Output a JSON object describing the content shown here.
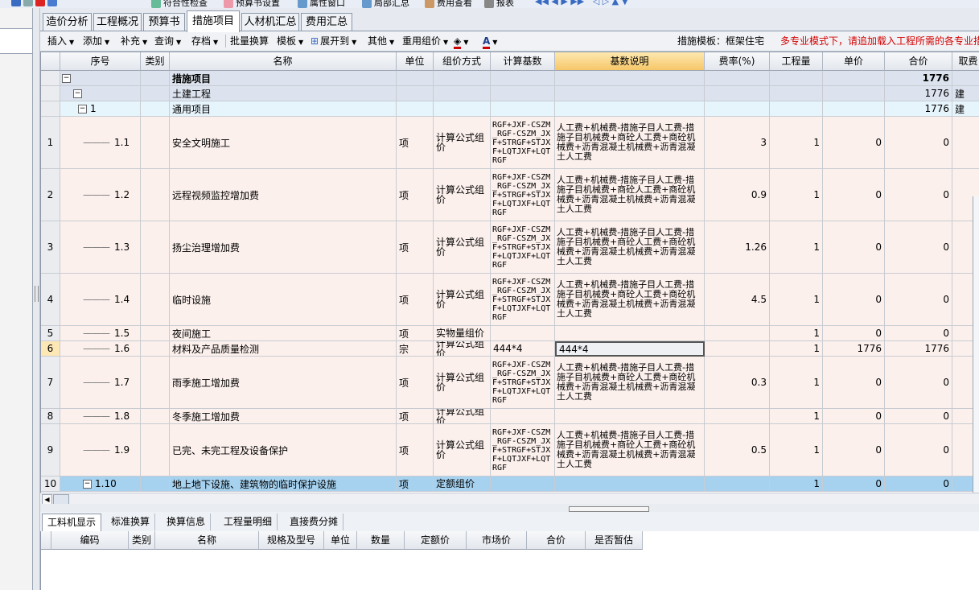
{
  "top_toolbar": {
    "items": [
      "符合性检查",
      "预算书设置",
      "属性窗口",
      "局部汇总",
      "费用查看",
      "报表"
    ]
  },
  "tabs": [
    {
      "label": "造价分析",
      "active": false
    },
    {
      "label": "工程概况",
      "active": false
    },
    {
      "label": "预算书",
      "active": false
    },
    {
      "label": "措施项目",
      "active": true
    },
    {
      "label": "人材机汇总",
      "active": false
    },
    {
      "label": "费用汇总",
      "active": false
    }
  ],
  "toolbar": {
    "insert": "插入",
    "add": "添加",
    "supplement": "补充",
    "query": "查询",
    "archive": "存档",
    "batch_convert": "批量换算",
    "template": "模板",
    "expand_to": "展开到",
    "other": "其他",
    "reuse_group": "重用组价",
    "template_status_label": "措施模板：框架住宅",
    "warning": "多专业模式下，请追加载入工程所需的各专业措施",
    "fill_color": "#cc0000",
    "font_color": "#cc0000"
  },
  "grid": {
    "columns": [
      "序号",
      "类别",
      "名称",
      "单位",
      "组价方式",
      "计算基数",
      "基数说明",
      "费率(%)",
      "工程量",
      "单价",
      "合价",
      "取费"
    ],
    "highlight_column": "基数说明",
    "group_rows": [
      {
        "name": "措施项目",
        "total": "1776",
        "level": 0,
        "bold": true
      },
      {
        "name": "土建工程",
        "total": "1776",
        "level": 1,
        "bold": false,
        "extra": "建"
      },
      {
        "code": "1",
        "name": "通用项目",
        "total": "1776",
        "level": 2,
        "bold": false,
        "extra": "建"
      }
    ],
    "formula": "RGF+JXF-CSZM_RGF-CSZM_JXF+STRGF+STJXF+LQTJXF+LQTRGF",
    "formula_desc": "人工费+机械费-措施子目人工费-措施子目机械费+商砼人工费+商砼机械费+沥青混凝土机械费+沥青混凝土人工费",
    "rows": [
      {
        "no": "1",
        "code": "1.1",
        "name": "安全文明施工",
        "unit": "项",
        "method": "计算公式组价",
        "base": "formula",
        "desc": "formula",
        "rate": "3",
        "qty": "1",
        "price": "0",
        "total": "0"
      },
      {
        "no": "2",
        "code": "1.2",
        "name": "远程视频监控增加费",
        "unit": "项",
        "method": "计算公式组价",
        "base": "formula",
        "desc": "formula",
        "rate": "0.9",
        "qty": "1",
        "price": "0",
        "total": "0"
      },
      {
        "no": "3",
        "code": "1.3",
        "name": "扬尘治理增加费",
        "unit": "项",
        "method": "计算公式组价",
        "base": "formula",
        "desc": "formula",
        "rate": "1.26",
        "qty": "1",
        "price": "0",
        "total": "0"
      },
      {
        "no": "4",
        "code": "1.4",
        "name": "临时设施",
        "unit": "项",
        "method": "计算公式组价",
        "base": "formula",
        "desc": "formula",
        "rate": "4.5",
        "qty": "1",
        "price": "0",
        "total": "0"
      },
      {
        "no": "5",
        "code": "1.5",
        "name": "夜间施工",
        "unit": "项",
        "method": "实物量组价",
        "base": "",
        "desc": "",
        "rate": "",
        "qty": "1",
        "price": "0",
        "total": "0"
      },
      {
        "no": "6",
        "code": "1.6",
        "name": "材料及产品质量检测",
        "unit": "宗",
        "method": "计算公式组价",
        "base": "444*4",
        "desc": "444*4",
        "rate": "",
        "qty": "1",
        "price": "1776",
        "total": "1776",
        "selected": true
      },
      {
        "no": "7",
        "code": "1.7",
        "name": "雨季施工增加费",
        "unit": "项",
        "method": "计算公式组价",
        "base": "formula",
        "desc": "formula",
        "rate": "0.3",
        "qty": "1",
        "price": "0",
        "total": "0"
      },
      {
        "no": "8",
        "code": "1.8",
        "name": "冬季施工增加费",
        "unit": "项",
        "method": "计算公式组价",
        "base": "",
        "desc": "",
        "rate": "",
        "qty": "1",
        "price": "0",
        "total": "0"
      },
      {
        "no": "9",
        "code": "1.9",
        "name": "已完、未完工程及设备保护",
        "unit": "项",
        "method": "计算公式组价",
        "base": "formula",
        "desc": "formula",
        "rate": "0.5",
        "qty": "1",
        "price": "0",
        "total": "0"
      },
      {
        "no": "10",
        "code": "1.10",
        "name": "地上地下设施、建筑物的临时保护设施",
        "unit": "项",
        "method": "定额组价",
        "base": "",
        "desc": "",
        "rate": "",
        "qty": "1",
        "price": "0",
        "total": "0",
        "expandable": true,
        "current": true
      }
    ]
  },
  "bottom_tabs": [
    {
      "label": "工料机显示",
      "active": true
    },
    {
      "label": "标准换算",
      "active": false
    },
    {
      "label": "换算信息",
      "active": false
    },
    {
      "label": "工程量明细",
      "active": false
    },
    {
      "label": "直接费分摊",
      "active": false
    }
  ],
  "bottom_grid": {
    "columns": [
      "编码",
      "类别",
      "名称",
      "规格及型号",
      "单位",
      "数量",
      "定额价",
      "市场价",
      "合价",
      "是否暂估"
    ]
  },
  "colors": {
    "group_row_bg": "#dce3ee",
    "level2_bg": "#e6f4fb",
    "item_bg": "#fbf0ec",
    "current_row_bg": "#a6d2f0",
    "selected_cell_border": "#555555"
  }
}
